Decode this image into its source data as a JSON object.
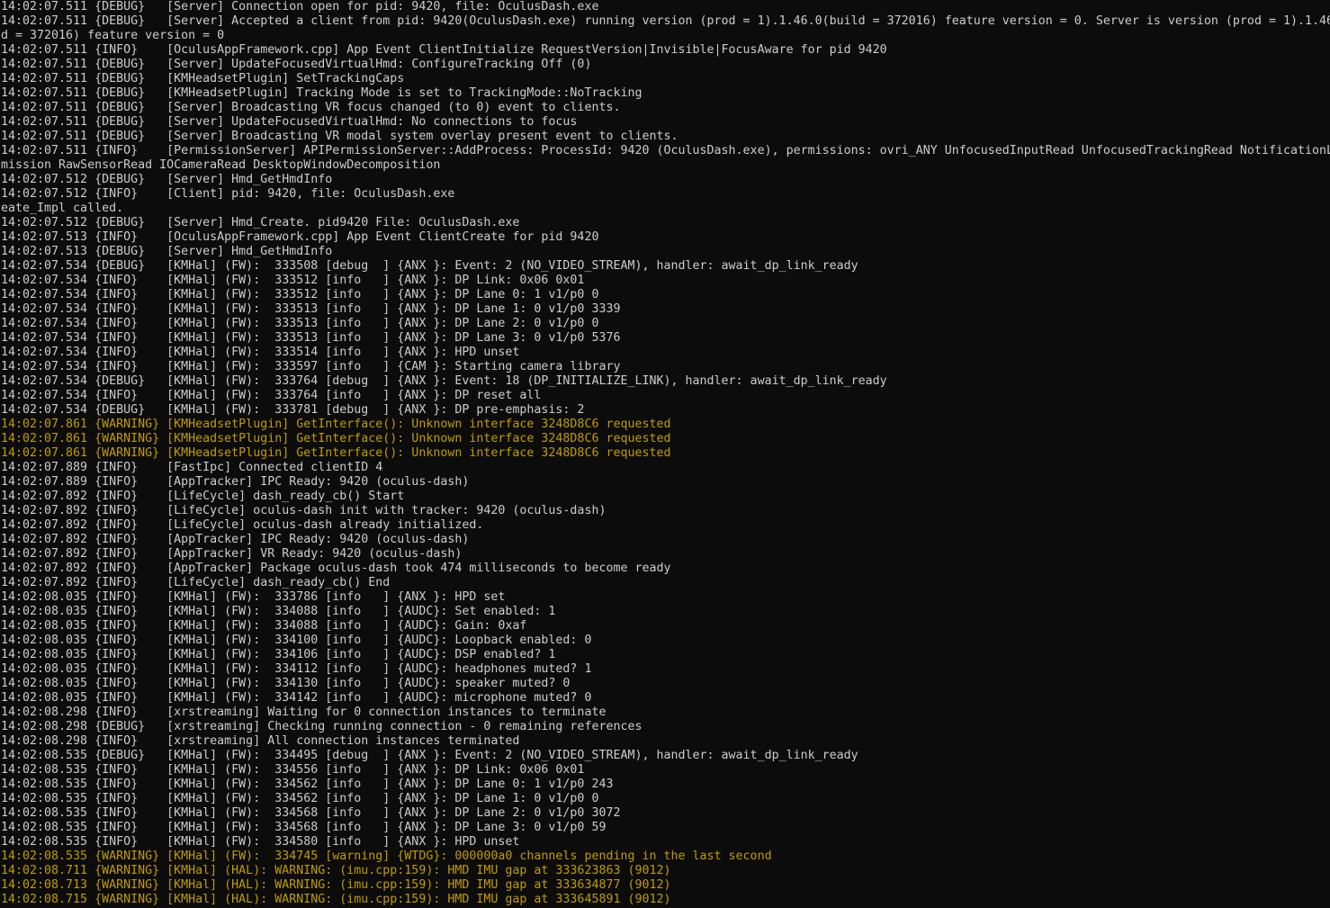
{
  "colors": {
    "background": "#0c0c0c",
    "text": "#cccccc",
    "warning": "#c19c00"
  },
  "lines": [
    {
      "level": "debug",
      "text": "14:02:07.511 {DEBUG}   [Server] Connection open for pid: 9420, file: OculusDash.exe"
    },
    {
      "level": "debug",
      "text": "14:02:07.511 {DEBUG}   [Server] Accepted a client from pid: 9420(OculusDash.exe) running version (prod = 1).1.46.0(build = 372016) feature version = 0. Server is version (prod = 1).1.46"
    },
    {
      "level": "cont",
      "text": "d = 372016) feature version = 0"
    },
    {
      "level": "info",
      "text": "14:02:07.511 {INFO}    [OculusAppFramework.cpp] App Event ClientInitialize RequestVersion|Invisible|FocusAware for pid 9420"
    },
    {
      "level": "debug",
      "text": "14:02:07.511 {DEBUG}   [Server] UpdateFocusedVirtualHmd: ConfigureTracking Off (0)"
    },
    {
      "level": "debug",
      "text": "14:02:07.511 {DEBUG}   [KMHeadsetPlugin] SetTrackingCaps"
    },
    {
      "level": "debug",
      "text": "14:02:07.511 {DEBUG}   [KMHeadsetPlugin] Tracking Mode is set to TrackingMode::NoTracking"
    },
    {
      "level": "debug",
      "text": "14:02:07.511 {DEBUG}   [Server] Broadcasting VR focus changed (to 0) event to clients."
    },
    {
      "level": "debug",
      "text": "14:02:07.511 {DEBUG}   [Server] UpdateFocusedVirtualHmd: No connections to focus"
    },
    {
      "level": "debug",
      "text": "14:02:07.511 {DEBUG}   [Server] Broadcasting VR modal system overlay present event to clients."
    },
    {
      "level": "info",
      "text": "14:02:07.511 {INFO}    [PermissionServer] APIPermissionServer::AddProcess: ProcessId: 9420 (OculusDash.exe), permissions: ovri_ANY UnfocusedInputRead UnfocusedTrackingRead NotificationL"
    },
    {
      "level": "cont",
      "text": "mission RawSensorRead IOCameraRead DesktopWindowDecomposition"
    },
    {
      "level": "debug",
      "text": "14:02:07.512 {DEBUG}   [Server] Hmd_GetHmdInfo"
    },
    {
      "level": "info",
      "text": "14:02:07.512 {INFO}    [Client] pid: 9420, file: OculusDash.exe"
    },
    {
      "level": "cont",
      "text": "eate_Impl called."
    },
    {
      "level": "debug",
      "text": "14:02:07.512 {DEBUG}   [Server] Hmd_Create. pid9420 File: OculusDash.exe"
    },
    {
      "level": "info",
      "text": "14:02:07.513 {INFO}    [OculusAppFramework.cpp] App Event ClientCreate for pid 9420"
    },
    {
      "level": "debug",
      "text": "14:02:07.513 {DEBUG}   [Server] Hmd_GetHmdInfo"
    },
    {
      "level": "debug",
      "text": "14:02:07.534 {DEBUG}   [KMHal] (FW):  333508 [debug  ] {ANX }: Event: 2 (NO_VIDEO_STREAM), handler: await_dp_link_ready"
    },
    {
      "level": "info",
      "text": "14:02:07.534 {INFO}    [KMHal] (FW):  333512 [info   ] {ANX }: DP Link: 0x06 0x01"
    },
    {
      "level": "info",
      "text": "14:02:07.534 {INFO}    [KMHal] (FW):  333512 [info   ] {ANX }: DP Lane 0: 1 v1/p0 0"
    },
    {
      "level": "info",
      "text": "14:02:07.534 {INFO}    [KMHal] (FW):  333513 [info   ] {ANX }: DP Lane 1: 0 v1/p0 3339"
    },
    {
      "level": "info",
      "text": "14:02:07.534 {INFO}    [KMHal] (FW):  333513 [info   ] {ANX }: DP Lane 2: 0 v1/p0 0"
    },
    {
      "level": "info",
      "text": "14:02:07.534 {INFO}    [KMHal] (FW):  333513 [info   ] {ANX }: DP Lane 3: 0 v1/p0 5376"
    },
    {
      "level": "info",
      "text": "14:02:07.534 {INFO}    [KMHal] (FW):  333514 [info   ] {ANX }: HPD unset"
    },
    {
      "level": "info",
      "text": "14:02:07.534 {INFO}    [KMHal] (FW):  333597 [info   ] {CAM }: Starting camera library"
    },
    {
      "level": "debug",
      "text": "14:02:07.534 {DEBUG}   [KMHal] (FW):  333764 [debug  ] {ANX }: Event: 18 (DP_INITIALIZE_LINK), handler: await_dp_link_ready"
    },
    {
      "level": "info",
      "text": "14:02:07.534 {INFO}    [KMHal] (FW):  333764 [info   ] {ANX }: DP reset all"
    },
    {
      "level": "debug",
      "text": "14:02:07.534 {DEBUG}   [KMHal] (FW):  333781 [debug  ] {ANX }: DP pre-emphasis: 2"
    },
    {
      "level": "warning",
      "text": "14:02:07.861 {WARNING} [KMHeadsetPlugin] GetInterface(): Unknown interface 3248D8C6 requested"
    },
    {
      "level": "warning",
      "text": "14:02:07.861 {WARNING} [KMHeadsetPlugin] GetInterface(): Unknown interface 3248D8C6 requested"
    },
    {
      "level": "warning",
      "text": "14:02:07.861 {WARNING} [KMHeadsetPlugin] GetInterface(): Unknown interface 3248D8C6 requested"
    },
    {
      "level": "info",
      "text": "14:02:07.889 {INFO}    [FastIpc] Connected clientID 4"
    },
    {
      "level": "info",
      "text": "14:02:07.889 {INFO}    [AppTracker] IPC Ready: 9420 (oculus-dash)"
    },
    {
      "level": "info",
      "text": "14:02:07.892 {INFO}    [LifeCycle] dash_ready_cb() Start"
    },
    {
      "level": "info",
      "text": "14:02:07.892 {INFO}    [LifeCycle] oculus-dash init with tracker: 9420 (oculus-dash)"
    },
    {
      "level": "info",
      "text": "14:02:07.892 {INFO}    [LifeCycle] oculus-dash already initialized."
    },
    {
      "level": "info",
      "text": "14:02:07.892 {INFO}    [AppTracker] IPC Ready: 9420 (oculus-dash)"
    },
    {
      "level": "info",
      "text": "14:02:07.892 {INFO}    [AppTracker] VR Ready: 9420 (oculus-dash)"
    },
    {
      "level": "info",
      "text": "14:02:07.892 {INFO}    [AppTracker] Package oculus-dash took 474 milliseconds to become ready"
    },
    {
      "level": "info",
      "text": "14:02:07.892 {INFO}    [LifeCycle] dash_ready_cb() End"
    },
    {
      "level": "info",
      "text": "14:02:08.035 {INFO}    [KMHal] (FW):  333786 [info   ] {ANX }: HPD set"
    },
    {
      "level": "info",
      "text": "14:02:08.035 {INFO}    [KMHal] (FW):  334088 [info   ] {AUDC}: Set enabled: 1"
    },
    {
      "level": "info",
      "text": "14:02:08.035 {INFO}    [KMHal] (FW):  334088 [info   ] {AUDC}: Gain: 0xaf"
    },
    {
      "level": "info",
      "text": "14:02:08.035 {INFO}    [KMHal] (FW):  334100 [info   ] {AUDC}: Loopback enabled: 0"
    },
    {
      "level": "info",
      "text": "14:02:08.035 {INFO}    [KMHal] (FW):  334106 [info   ] {AUDC}: DSP enabled? 1"
    },
    {
      "level": "info",
      "text": "14:02:08.035 {INFO}    [KMHal] (FW):  334112 [info   ] {AUDC}: headphones muted? 1"
    },
    {
      "level": "info",
      "text": "14:02:08.035 {INFO}    [KMHal] (FW):  334130 [info   ] {AUDC}: speaker muted? 0"
    },
    {
      "level": "info",
      "text": "14:02:08.035 {INFO}    [KMHal] (FW):  334142 [info   ] {AUDC}: microphone muted? 0"
    },
    {
      "level": "info",
      "text": "14:02:08.298 {INFO}    [xrstreaming] Waiting for 0 connection instances to terminate"
    },
    {
      "level": "debug",
      "text": "14:02:08.298 {DEBUG}   [xrstreaming] Checking running connection - 0 remaining references"
    },
    {
      "level": "info",
      "text": "14:02:08.298 {INFO}    [xrstreaming] All connection instances terminated"
    },
    {
      "level": "debug",
      "text": "14:02:08.535 {DEBUG}   [KMHal] (FW):  334495 [debug  ] {ANX }: Event: 2 (NO_VIDEO_STREAM), handler: await_dp_link_ready"
    },
    {
      "level": "info",
      "text": "14:02:08.535 {INFO}    [KMHal] (FW):  334556 [info   ] {ANX }: DP Link: 0x06 0x01"
    },
    {
      "level": "info",
      "text": "14:02:08.535 {INFO}    [KMHal] (FW):  334562 [info   ] {ANX }: DP Lane 0: 1 v1/p0 243"
    },
    {
      "level": "info",
      "text": "14:02:08.535 {INFO}    [KMHal] (FW):  334562 [info   ] {ANX }: DP Lane 1: 0 v1/p0 0"
    },
    {
      "level": "info",
      "text": "14:02:08.535 {INFO}    [KMHal] (FW):  334568 [info   ] {ANX }: DP Lane 2: 0 v1/p0 3072"
    },
    {
      "level": "info",
      "text": "14:02:08.535 {INFO}    [KMHal] (FW):  334568 [info   ] {ANX }: DP Lane 3: 0 v1/p0 59"
    },
    {
      "level": "info",
      "text": "14:02:08.535 {INFO}    [KMHal] (FW):  334580 [info   ] {ANX }: HPD unset"
    },
    {
      "level": "warning",
      "text": "14:02:08.535 {WARNING} [KMHal] (FW):  334745 [warning] {WTDG}: 000000a0 channels pending in the last second"
    },
    {
      "level": "warning",
      "text": "14:02:08.711 {WARNING} [KMHal] (HAL): WARNING: (imu.cpp:159): HMD IMU gap at 333623863 (9012)"
    },
    {
      "level": "warning",
      "text": "14:02:08.713 {WARNING} [KMHal] (HAL): WARNING: (imu.cpp:159): HMD IMU gap at 333634877 (9012)"
    },
    {
      "level": "warning",
      "text": "14:02:08.715 {WARNING} [KMHal] (HAL): WARNING: (imu.cpp:159): HMD IMU gap at 333645891 (9012)"
    }
  ]
}
